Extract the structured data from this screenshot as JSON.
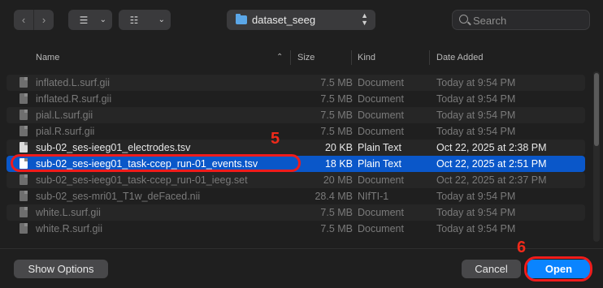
{
  "toolbar": {
    "back_icon": "chevron-left-icon",
    "forward_icon": "chevron-right-icon",
    "list_view_icon": "list-view-icon",
    "grid_view_icon": "grid-view-icon",
    "location": "dataset_seeg",
    "search_placeholder": "Search"
  },
  "columns": {
    "name": "Name",
    "size": "Size",
    "kind": "Kind",
    "date_added": "Date Added"
  },
  "files": [
    {
      "name": "inflated.L.surf.gii",
      "size": "7.5 MB",
      "kind": "Document",
      "date": "Today at 9:54 PM",
      "state": "dim"
    },
    {
      "name": "inflated.R.surf.gii",
      "size": "7.5 MB",
      "kind": "Document",
      "date": "Today at 9:54 PM",
      "state": "dim"
    },
    {
      "name": "pial.L.surf.gii",
      "size": "7.5 MB",
      "kind": "Document",
      "date": "Today at 9:54 PM",
      "state": "dim"
    },
    {
      "name": "pial.R.surf.gii",
      "size": "7.5 MB",
      "kind": "Document",
      "date": "Today at 9:54 PM",
      "state": "dim"
    },
    {
      "name": "sub-02_ses-ieeg01_electrodes.tsv",
      "size": "20 KB",
      "kind": "Plain Text",
      "date": "Oct 22, 2025 at 2:38 PM",
      "state": "norm"
    },
    {
      "name": "sub-02_ses-ieeg01_task-ccep_run-01_events.tsv",
      "size": "18 KB",
      "kind": "Plain Text",
      "date": "Oct 22, 2025 at 2:51 PM",
      "state": "sel"
    },
    {
      "name": "sub-02_ses-ieeg01_task-ccep_run-01_ieeg.set",
      "size": "20 MB",
      "kind": "Document",
      "date": "Oct 22, 2025 at 2:37 PM",
      "state": "dim"
    },
    {
      "name": "sub-02_ses-mri01_T1w_deFaced.nii",
      "size": "28.4 MB",
      "kind": "NIfTI-1",
      "date": "Today at 9:54 PM",
      "state": "dim"
    },
    {
      "name": "white.L.surf.gii",
      "size": "7.5 MB",
      "kind": "Document",
      "date": "Today at 9:54 PM",
      "state": "dim"
    },
    {
      "name": "white.R.surf.gii",
      "size": "7.5 MB",
      "kind": "Document",
      "date": "Today at 9:54 PM",
      "state": "dim"
    }
  ],
  "footer": {
    "show_options": "Show Options",
    "cancel": "Cancel",
    "open": "Open"
  },
  "annotations": {
    "step5": "5",
    "step6": "6",
    "color": "#ef1c1c"
  },
  "colors": {
    "selection": "#0a57c9",
    "accent": "#0a84ff",
    "folder": "#5ba7e8"
  }
}
